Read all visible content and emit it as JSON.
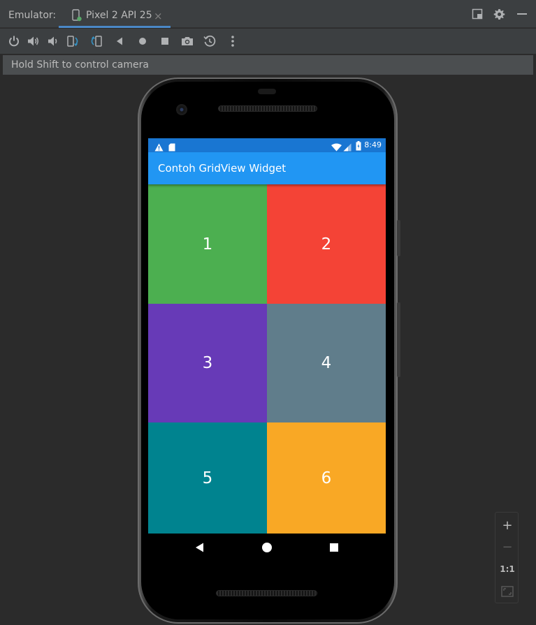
{
  "window": {
    "label": "Emulator:",
    "tab_title": "Pixel 2 API 25",
    "tab_close": "×"
  },
  "toolbar": {
    "buttons": [
      {
        "name": "power-icon"
      },
      {
        "name": "volume-up-icon"
      },
      {
        "name": "volume-down-icon"
      },
      {
        "name": "rotate-left-icon"
      },
      {
        "name": "rotate-right-icon"
      },
      {
        "name": "back-icon"
      },
      {
        "name": "home-icon"
      },
      {
        "name": "overview-icon"
      },
      {
        "name": "screenshot-icon"
      },
      {
        "name": "snapshot-icon"
      },
      {
        "name": "more-icon"
      }
    ]
  },
  "info": {
    "message": "Hold Shift to control camera"
  },
  "device": {
    "status_time": "8:49",
    "app_title": "Contoh GridView Widget",
    "status_icons": [
      "warning-icon",
      "sd-card-icon",
      "wifi-icon",
      "signal-icon",
      "battery-icon"
    ]
  },
  "grid": {
    "items": [
      {
        "label": "1",
        "color": "#4caf50"
      },
      {
        "label": "2",
        "color": "#f44336"
      },
      {
        "label": "3",
        "color": "#673ab7"
      },
      {
        "label": "4",
        "color": "#607d8b"
      },
      {
        "label": "5",
        "color": "#00838f"
      },
      {
        "label": "6",
        "color": "#f9a825"
      }
    ]
  },
  "zoom": {
    "zoom_in": "+",
    "zoom_out": "−",
    "actual_size": "1:1"
  },
  "colors": {
    "accent": "#4a88c7",
    "appbar": "#2196f3",
    "statusbar": "#1976d2"
  }
}
